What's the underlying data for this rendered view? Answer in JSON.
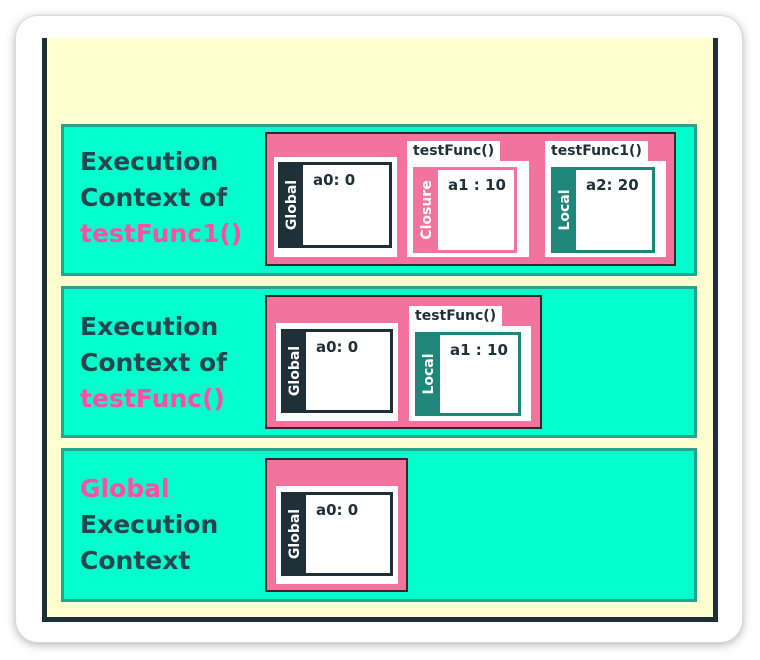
{
  "rows": [
    {
      "label_line1": "Execution",
      "label_line2": "Context of",
      "label_highlight": "testFunc1()",
      "scopes": [
        {
          "type": "Global",
          "var": "a0: 0"
        },
        {
          "tab": "testFunc()",
          "type": "Closure",
          "var": "a1 : 10"
        },
        {
          "tab": "testFunc1()",
          "type": "Local",
          "var": "a2: 20"
        }
      ]
    },
    {
      "label_line1": "Execution",
      "label_line2": "Context of",
      "label_highlight": "testFunc()",
      "scopes": [
        {
          "type": "Global",
          "var": "a0: 0"
        },
        {
          "tab": "testFunc()",
          "type": "Local",
          "var": "a1 : 10"
        }
      ]
    },
    {
      "label_highlight": "Global",
      "label_line1": "Execution",
      "label_line2": "Context",
      "scopes": [
        {
          "type": "Global",
          "var": "a0: 0"
        }
      ]
    }
  ],
  "colors": {
    "background": "#ffffcf",
    "row": "#00ffcc",
    "context": "#f2739e",
    "global_strip": "#1f3038",
    "local_strip": "#21867a",
    "highlight_text": "#ff4fa0"
  }
}
